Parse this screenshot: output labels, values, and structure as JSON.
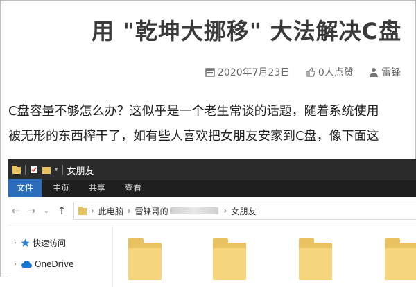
{
  "article": {
    "title": "用 \"乾坤大挪移\" 大法解决C盘",
    "meta": {
      "date": "2020年7月23日",
      "likes": "0人点赞",
      "author": "雷锋"
    },
    "paragraph_line1": "C盘容量不够怎么办？这似乎是一个老生常谈的话题，随着系统使用",
    "paragraph_line2": "被无形的东西榨干了，如有些人喜欢把女朋友安家到C盘，像下面这"
  },
  "explorer": {
    "window_title": "女朋友",
    "ribbon_tabs": [
      "文件",
      "主页",
      "共享",
      "查看"
    ],
    "breadcrumb": [
      "此电脑",
      "雷锋哥的",
      "女朋友"
    ],
    "sidebar": [
      "快速访问",
      "OneDrive"
    ],
    "colors": {
      "ribbon_active": "#2c6dbb",
      "folder": "#f6d57d",
      "titlebar": "#2b2b2b"
    }
  }
}
